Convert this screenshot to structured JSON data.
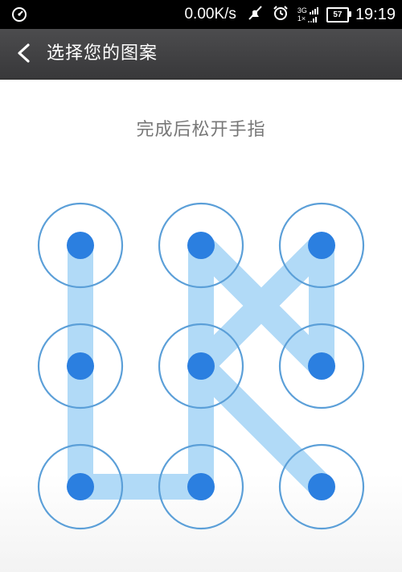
{
  "status_bar": {
    "net_speed": "0.00K/s",
    "network_type": "3G",
    "network_sub": "1×",
    "battery": "57",
    "time": "19:19",
    "icons": [
      "speedometer-icon",
      "silent-mode-icon",
      "alarm-icon",
      "signal-icon",
      "battery-icon"
    ]
  },
  "header": {
    "title": "选择您的图案",
    "back_icon": "chevron-left-icon"
  },
  "main": {
    "hint": "完成后松开手指"
  },
  "pattern": {
    "grid_size": 3,
    "selected_sequence": [
      1,
      4,
      7,
      8,
      5,
      2,
      6,
      3,
      5,
      9
    ],
    "colors": {
      "ring": "#5b9fd8",
      "dot": "#2b7fe0",
      "path": "#a9d6f6",
      "background": "#ffffff"
    }
  }
}
